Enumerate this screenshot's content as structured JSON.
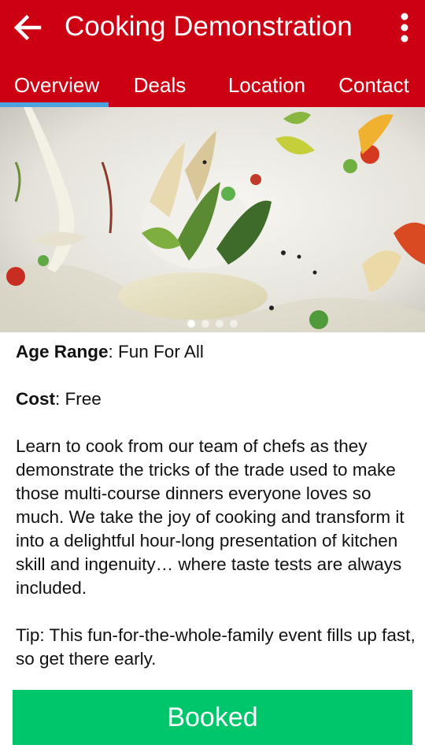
{
  "appbar": {
    "title": "Cooking Demonstration",
    "back_icon": "arrow-left-icon",
    "menu_icon": "more-vertical-icon",
    "color": "#cc0012"
  },
  "tabs": [
    {
      "label": "Overview",
      "active": true
    },
    {
      "label": "Deals",
      "active": false
    },
    {
      "label": "Location",
      "active": false
    },
    {
      "label": "Contact",
      "active": false
    }
  ],
  "tab_indicator_color": "#4aa3df",
  "carousel": {
    "slide_count": 4,
    "active_index": 0
  },
  "details": {
    "age_label": "Age Range",
    "age_value": ": Fun For All",
    "cost_label": "Cost",
    "cost_value": ": Free",
    "description": "Learn to cook from our team of chefs as they demonstrate the tricks of the trade used to make those multi-course dinners everyone loves so much. We take the joy of cooking and transform it into a delightful hour-long presentation of kitchen skill and ingenuity… where taste tests are always included.",
    "tip": "Tip: This fun-for-the-whole-family event fills up fast, so get there early."
  },
  "action_button": {
    "label": "Booked",
    "color": "#00c66b"
  }
}
